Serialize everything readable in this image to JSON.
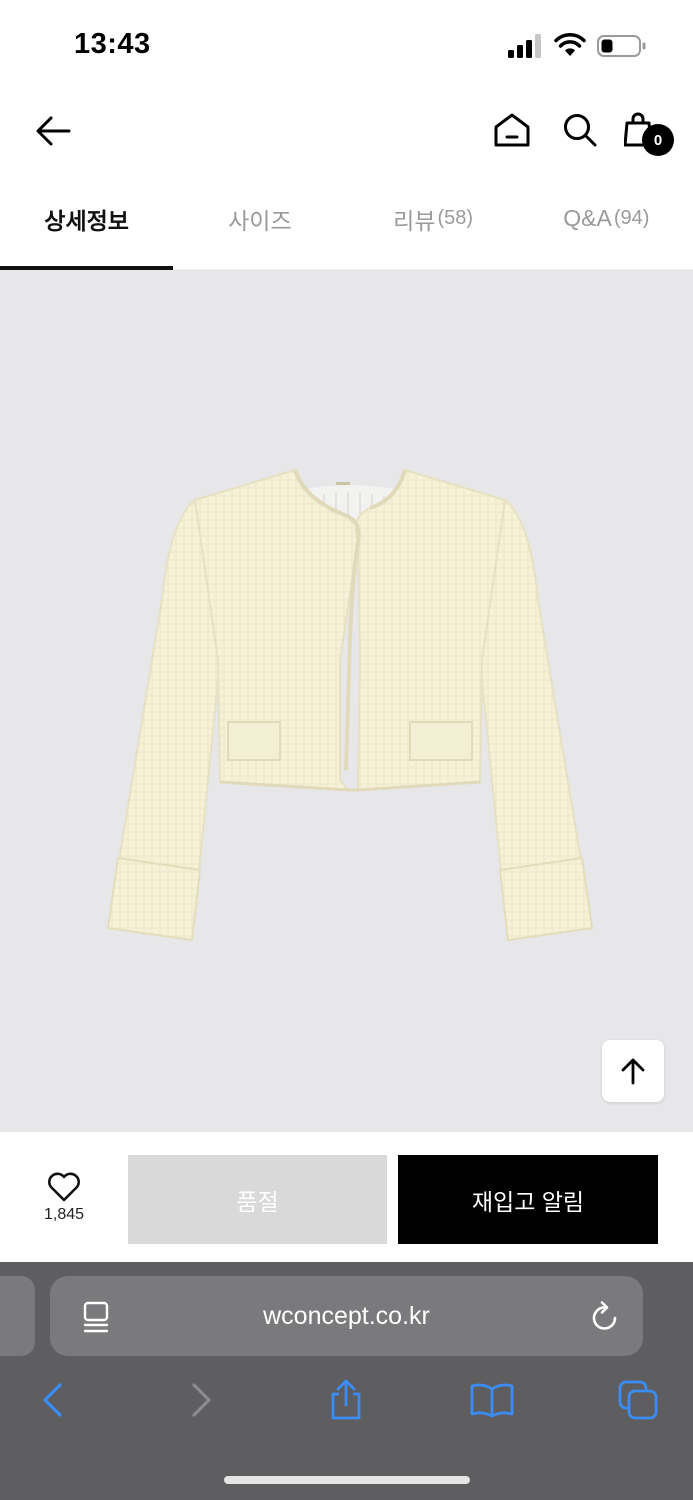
{
  "status_bar": {
    "time": "13:43"
  },
  "header": {
    "cart_count": "0"
  },
  "tabs": [
    {
      "label": "상세정보",
      "count": "",
      "active": true
    },
    {
      "label": "사이즈",
      "count": "",
      "active": false
    },
    {
      "label": "리뷰",
      "count": "(58)",
      "active": false
    },
    {
      "label": "Q&A",
      "count": "(94)",
      "active": false
    }
  ],
  "product": {
    "image_icon": "cream-tweed-jacket-photo",
    "background_color": "#e7e7e9"
  },
  "actions": {
    "like_count": "1,845",
    "soldout_label": "품절",
    "restock_label": "재입고 알림"
  },
  "browser": {
    "url": "wconcept.co.kr"
  },
  "colors": {
    "accent": "#000000",
    "soldout_bg": "#d9d9d9",
    "toolbar_bg": "#5e5e60",
    "safari_blue": "#3b8cf5"
  }
}
